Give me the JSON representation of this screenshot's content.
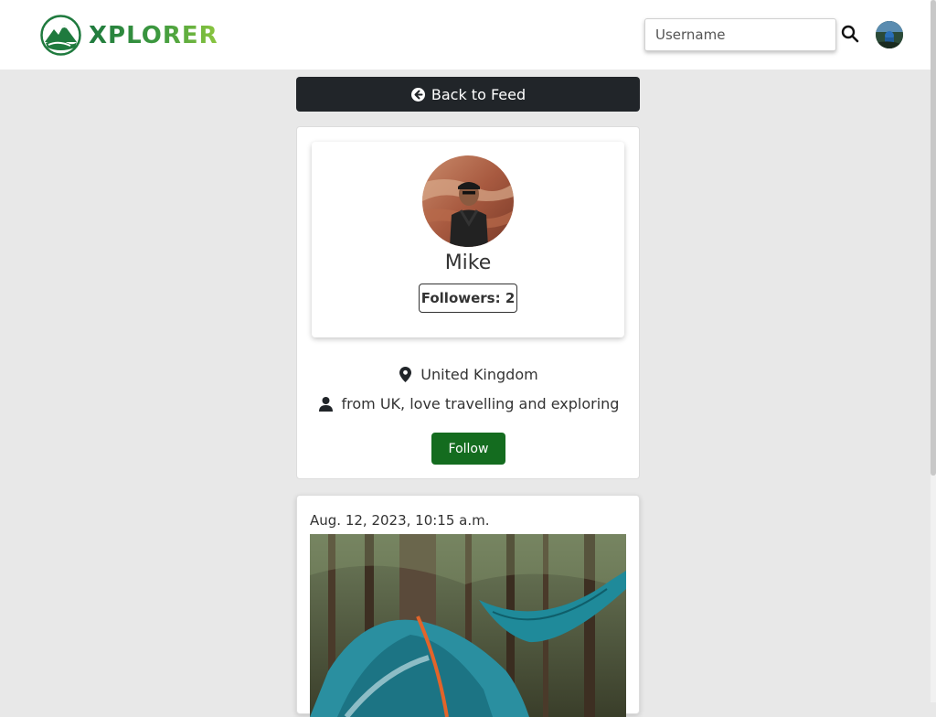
{
  "navbar": {
    "brand_name": "XPLORER",
    "search": {
      "placeholder": "Username",
      "value": ""
    }
  },
  "back_button": {
    "label": "Back to Feed"
  },
  "profile": {
    "name": "Mike",
    "followers_label": "Followers: 2",
    "location": "United Kingdom",
    "bio": "from UK, love travelling and exploring",
    "follow_label": "Follow"
  },
  "post": {
    "date": "Aug. 12, 2023, 10:15 a.m."
  },
  "colors": {
    "brand_green": "#1f7a3e",
    "follow_green": "#146c1f",
    "dark_button": "#212529",
    "page_bg": "#e8e8e8"
  },
  "icons": [
    "mountain-logo-icon",
    "search-icon",
    "arrow-circle-left-icon",
    "map-pin-icon",
    "user-icon"
  ]
}
